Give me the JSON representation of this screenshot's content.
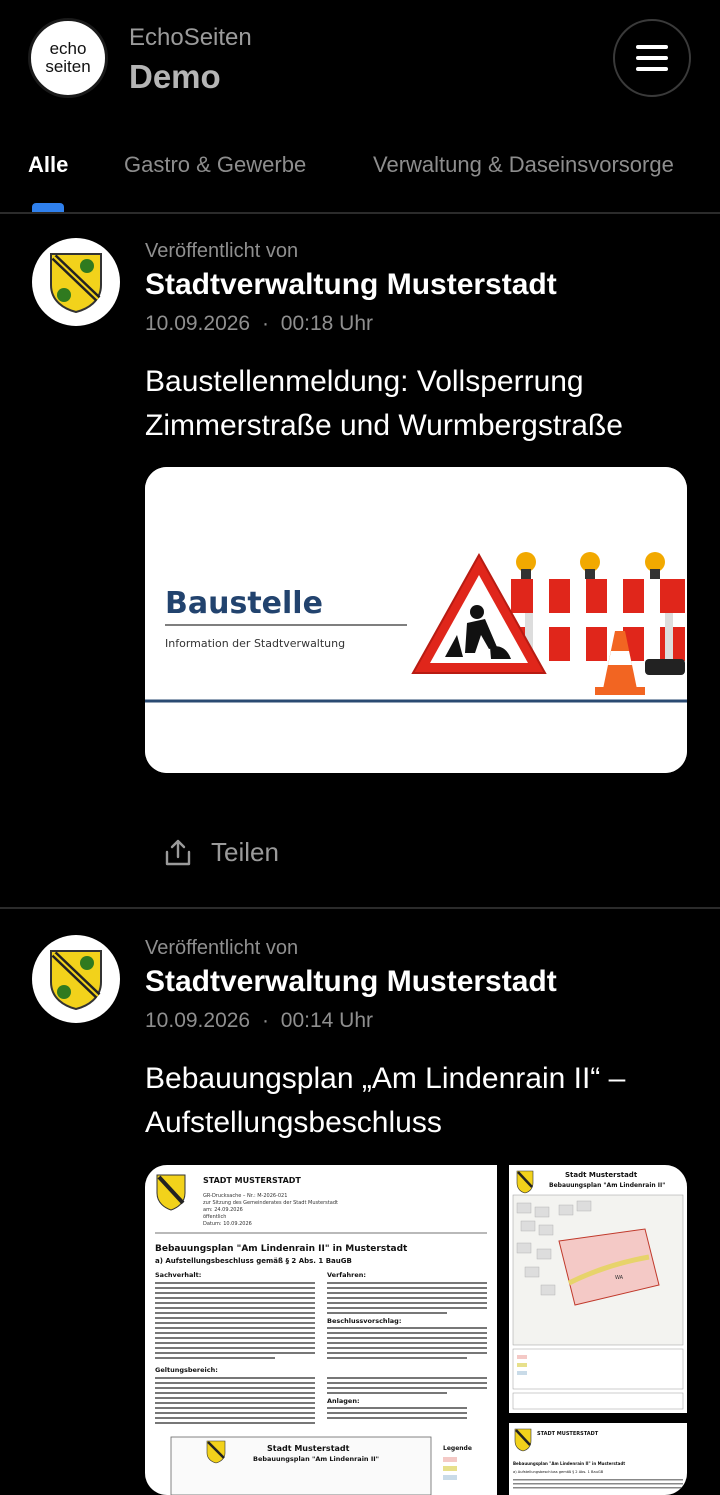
{
  "header": {
    "logo_line1": "echo",
    "logo_line2": "seiten",
    "app_name": "EchoSeiten",
    "app_subtitle": "Demo"
  },
  "tabs": [
    {
      "label": "Alle",
      "active": true
    },
    {
      "label": "Gastro & Gewerbe",
      "active": false
    },
    {
      "label": "Verwaltung & Daseinsvorsorge",
      "active": false
    }
  ],
  "posts": [
    {
      "meta_label": "Veröffentlicht von",
      "publisher": "Stadtverwaltung Musterstadt",
      "date": "10.09.2026",
      "time": "00:18 Uhr",
      "title": "Baustellenmeldung: Vollsperrung Zimmerstraße und Wurmbergstraße",
      "image": {
        "heading": "Baustelle",
        "caption": "Information der Stadtverwaltung"
      },
      "share_label": "Teilen"
    },
    {
      "meta_label": "Veröffentlicht von",
      "publisher": "Stadtverwaltung Musterstadt",
      "date": "10.09.2026",
      "time": "00:14 Uhr",
      "title": "Bebauungsplan „Am Lindenrain II“ – Aufstellungsbeschluss",
      "doc": {
        "city": "STADT MUSTERSTADT",
        "drucksache": "GR-Drucksache – Nr.: M-2026-021",
        "sitzung": "zur Sitzung des Gemeinderates der Stadt Musterstadt",
        "am": "am: 24.09.2026",
        "oeffentlich": "öffentlich",
        "datum": "Datum: 10.09.2026",
        "heading": "Bebauungsplan \"Am Lindenrain II\" in Musterstadt",
        "subheading": "a) Aufstellungsbeschluss gemäß § 2 Abs. 1 BauGB",
        "sachverhalt": "Sachverhalt:",
        "verfahren": "Verfahren:",
        "beschluss": "Beschlussvorschlag:",
        "geltungsbereich": "Geltungsbereich:",
        "anlagen": "Anlagen:",
        "map_title": "Stadt Musterstadt",
        "map_subtitle": "Bebauungsplan \"Am Lindenrain II\"",
        "legend": "Legende",
        "wa_label": "WA"
      }
    }
  ],
  "colors": {
    "accent": "#2f80ed",
    "background": "#000000",
    "sign_red": "#e0261b",
    "coat_yellow": "#f2d21b",
    "coat_green": "#2f7a1f"
  }
}
